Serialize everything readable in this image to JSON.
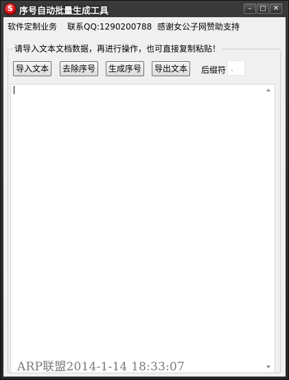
{
  "window": {
    "title": "序号自动批量生成工具",
    "icon_glyph": "S",
    "controls": {
      "minimize": "–",
      "maximize": "□",
      "close": "✕"
    }
  },
  "info_bar": {
    "service": "软件定制业务",
    "contact": "联系QQ:1290200788",
    "thanks": "感谢女公子网赞助支持"
  },
  "group": {
    "legend": "请导入文本文档数据，再进行操作，也可直接复制粘贴！"
  },
  "toolbar": {
    "import_label": "导入文本",
    "remove_label": "去除序号",
    "generate_label": "生成序号",
    "export_label": "导出文本",
    "suffix_label": "后缀符",
    "suffix_value": "、"
  },
  "editor": {
    "content": ""
  },
  "watermark": "ARP联盟2014-1-14 18:33:07"
}
